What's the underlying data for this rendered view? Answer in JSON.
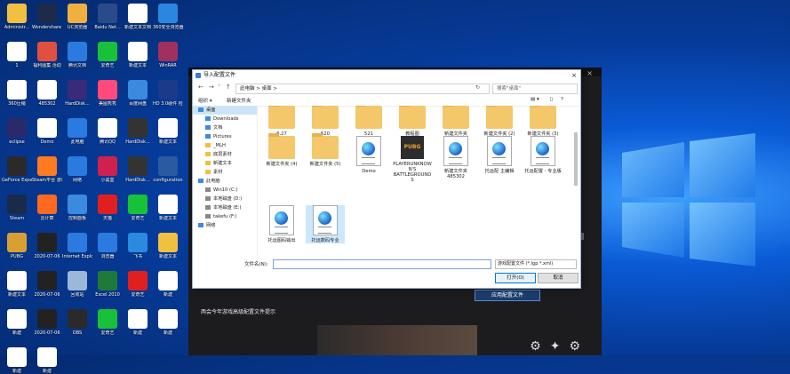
{
  "desktop": {
    "icons": [
      {
        "label": "Administr...",
        "color": "#f0c040"
      },
      {
        "label": "Wondershare\nfilmora9",
        "color": "#1e2a4a"
      },
      {
        "label": "UC浏览器",
        "color": "#f0b040"
      },
      {
        "label": "Baidu Net...",
        "color": "#2a4a8a"
      },
      {
        "label": "新建文本文档",
        "color": "#ffffff"
      },
      {
        "label": "360安全浏览器",
        "color": "#2a86e0"
      },
      {
        "label": "1",
        "color": "#ffffff"
      },
      {
        "label": "福利图集\n活动",
        "color": "#e05040"
      },
      {
        "label": "腾讯文档",
        "color": "#2a7ae0"
      },
      {
        "label": "爱奇艺",
        "color": "#17c23a"
      },
      {
        "label": "新建文本",
        "color": "#ffffff"
      },
      {
        "label": "WinRAR",
        "color": "#a03060"
      },
      {
        "label": "360压缩",
        "color": "#ffffff"
      },
      {
        "label": "485302",
        "color": "#ffffff"
      },
      {
        "label": "HardDisk...",
        "color": "#3a2a7a"
      },
      {
        "label": "美图秀秀",
        "color": "#ff4a7a"
      },
      {
        "label": "百度网盘",
        "color": "#3a8ae0"
      },
      {
        "label": "HD 3.0硬件\n检测工具",
        "color": "#1a3a8a"
      },
      {
        "label": "eclipse",
        "color": "#2a2a6a"
      },
      {
        "label": "Demo",
        "color": "#ffffff"
      },
      {
        "label": "此电脑",
        "color": "#2a7ae0"
      },
      {
        "label": "腾讯QQ",
        "color": "#ffffff"
      },
      {
        "label": "HardDisk...",
        "color": "#333333"
      },
      {
        "label": "新建文本",
        "color": "#ffffff"
      },
      {
        "label": "GeForce\nExperience",
        "color": "#2a2a2a"
      },
      {
        "label": "Steam平台\n游戏",
        "color": "#ff7a20"
      },
      {
        "label": "网络",
        "color": "#2a7ae0"
      },
      {
        "label": "小黑盒",
        "color": "#d02050"
      },
      {
        "label": "HardDisk...",
        "color": "#333333"
      },
      {
        "label": "configuration",
        "color": "#2a5aa0"
      },
      {
        "label": "Steam",
        "color": "#1a2a4a"
      },
      {
        "label": "云计算",
        "color": "#ff6a20"
      },
      {
        "label": "控制面板",
        "color": "#3a8ae0"
      },
      {
        "label": "天猫",
        "color": "#e02020"
      },
      {
        "label": "爱奇艺",
        "color": "#17c23a"
      },
      {
        "label": "新建文本",
        "color": "#ffffff"
      },
      {
        "label": "PUBG",
        "color": "#d8a030"
      },
      {
        "label": "2020-07-06",
        "color": "#222222"
      },
      {
        "label": "Internet\nExplorer",
        "color": "#2a7ae0"
      },
      {
        "label": "浏览器",
        "color": "#2a7ae0"
      },
      {
        "label": "飞书",
        "color": "#2a8ae0"
      },
      {
        "label": "新建文本",
        "color": "#f0c040"
      },
      {
        "label": "新建文本",
        "color": "#ffffff"
      },
      {
        "label": "2020-07-06",
        "color": "#222222"
      },
      {
        "label": "回收站",
        "color": "#9ab8d8"
      },
      {
        "label": "Excel 2010",
        "color": "#1e7a3a"
      },
      {
        "label": "爱奇艺",
        "color": "#e02020"
      },
      {
        "label": "新建",
        "color": "#ffffff"
      },
      {
        "label": "新建",
        "color": "#ffffff"
      },
      {
        "label": "2020-07-06",
        "color": "#222222"
      },
      {
        "label": "OBS",
        "color": "#2a2a2a"
      },
      {
        "label": "爱奇艺",
        "color": "#17c23a"
      },
      {
        "label": "新建",
        "color": "#ffffff"
      },
      {
        "label": "新建",
        "color": "#ffffff"
      },
      {
        "label": "新建",
        "color": "#ffffff"
      },
      {
        "label": "新建",
        "color": "#ffffff"
      }
    ]
  },
  "background_app": {
    "tip": "两会今年游戏高级配置文件提示",
    "generate_button": "应用配置文件",
    "close": "×"
  },
  "dialog": {
    "title": "导入配置文件",
    "close": "×",
    "address": "此电脑  >  桌面  >",
    "search_placeholder": "搜索\"桌面\"",
    "toolbar": {
      "organize": "组织 ▾",
      "new_folder": "新建文件夹"
    },
    "sidebar": [
      {
        "label": "桌面",
        "selected": true,
        "color": "#3a8ae0"
      },
      {
        "label": "Downloads",
        "selected": false,
        "color": "#3a8ae0"
      },
      {
        "label": "文档",
        "selected": false,
        "color": "#3a8ae0"
      },
      {
        "label": "Pictures",
        "selected": false,
        "color": "#3a8ae0"
      },
      {
        "label": "_MLH",
        "selected": false,
        "color": "#f0c040"
      },
      {
        "label": "底层素材",
        "selected": false,
        "color": "#f0c040"
      },
      {
        "label": "新建文本",
        "selected": false,
        "color": "#f0c040"
      },
      {
        "label": "素材",
        "selected": false,
        "color": "#f0c040"
      },
      {
        "label": "此电脑",
        "selected": false,
        "color": "#3a8ae0"
      },
      {
        "label": "Win10 (C:)",
        "selected": false,
        "color": "#888888"
      },
      {
        "label": "本地磁盘 (D:)",
        "selected": false,
        "color": "#888888"
      },
      {
        "label": "本地磁盘 (E:)",
        "selected": false,
        "color": "#888888"
      },
      {
        "label": "takefu (F:)",
        "selected": false,
        "color": "#888888"
      },
      {
        "label": "网络",
        "selected": false,
        "color": "#3a8ae0"
      }
    ],
    "files_row0": [
      {
        "label": "6.27",
        "type": "folder"
      },
      {
        "label": "520",
        "type": "folder"
      },
      {
        "label": "521",
        "type": "folder"
      },
      {
        "label": "教程图",
        "type": "folder"
      },
      {
        "label": "新建文件夹",
        "type": "folder"
      },
      {
        "label": "新建文件夹 (2)",
        "type": "folder"
      },
      {
        "label": "新建文件夹 (3)",
        "type": "folder"
      }
    ],
    "files_row1": [
      {
        "label": "新建文件夹 (4)",
        "type": "folder"
      },
      {
        "label": "新建文件夹 (5)",
        "type": "folder"
      },
      {
        "label": "Demo",
        "type": "doc"
      },
      {
        "label": "PLAYERUNKNOWN'S BATTLEGROUNDS",
        "type": "pubg"
      },
      {
        "label": "新建文件夹485302",
        "type": "doc"
      },
      {
        "label": "托运配 主编辑",
        "type": "doc"
      },
      {
        "label": "托运配置 - 专业版",
        "type": "doc"
      }
    ],
    "files_row2": [
      {
        "label": "托运图码输出",
        "type": "doc",
        "selected": false
      },
      {
        "label": "托运数码专业",
        "type": "doc",
        "selected": true
      }
    ],
    "pubg_text": "PUBG",
    "file_name_label": "文件名(N):",
    "file_name_value": "",
    "file_type": "游戏配置文件 (*.lgp *.xml)",
    "open_button": "打开(O)",
    "cancel_button": "取消"
  }
}
